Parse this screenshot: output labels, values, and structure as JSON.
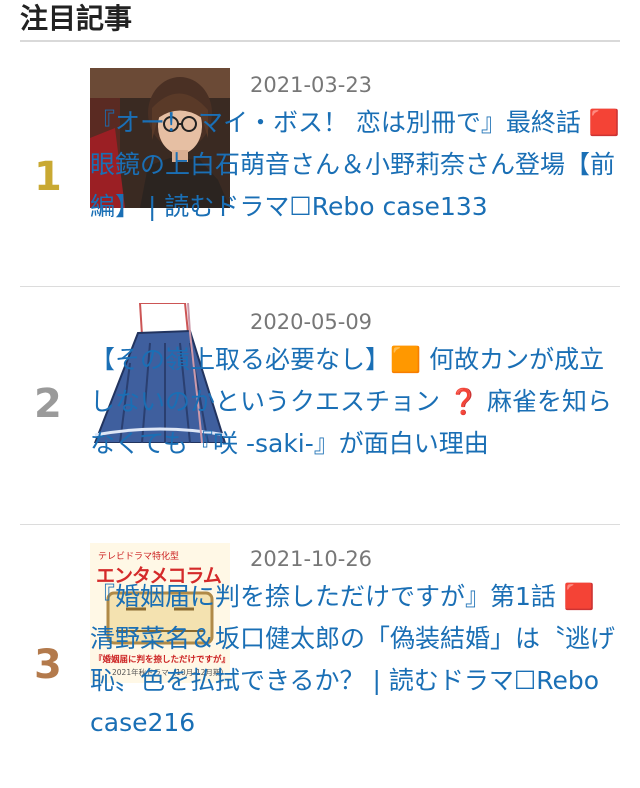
{
  "widget": {
    "title": "注目記事"
  },
  "articles": [
    {
      "rank": "1",
      "rank_color": "#c9a932",
      "date": "2021-03-23",
      "title": "『オー！ マイ・ボス！ 恋は別冊で』最終話 🟥 眼鏡の上白石萌音さん＆小野莉奈さん登場【前編】 | 読むドラマ☐Rebo case133",
      "thumb_icon": "woman-with-glasses-photo"
    },
    {
      "rank": "2",
      "rank_color": "#9a9a9a",
      "date": "2020-05-09",
      "title": "【その嶺上取る必要なし】🟧 何故カンが成立しないのかというクエスチョン ❓ 麻雀を知らなくても『咲 -saki-』が面白い理由",
      "thumb_icon": "anime-girl-skirt-illustration"
    },
    {
      "rank": "3",
      "rank_color": "#b37a4c",
      "date": "2021-10-26",
      "title": "『婚姻届に判を捺しただけですが』第1話 🟥 清野菜名＆坂口健太郎の「偽装結婚」は〝逃げ恥〟色を払拭できるか？ | 読むドラマ☐Rebo case216",
      "thumb_icon": "entame-column-banner",
      "thumb_text": {
        "kicker": "テレビドラマ特化型",
        "brand": "エンタメコラム",
        "caption": "『婚姻届に判を捺しただけですが』",
        "season": "2021年秋ドラマ（10月-12月期）"
      }
    }
  ]
}
